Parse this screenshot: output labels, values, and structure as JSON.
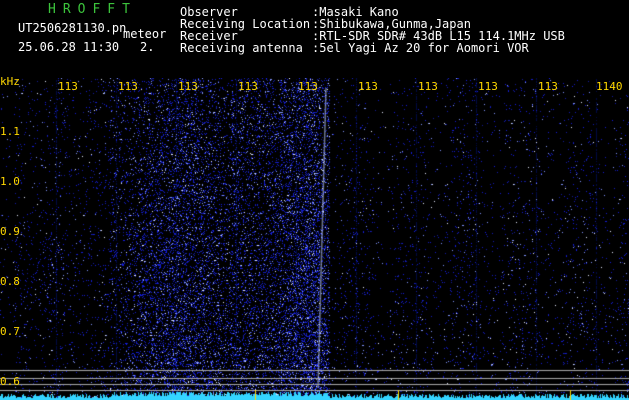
{
  "header": {
    "brand": "HROFFT",
    "filename": "UT2506281130.pn",
    "tag": "meteor",
    "datetime": "25.06.28 11:30",
    "count": "2.",
    "observer_key": "Observer",
    "observer_val": ":Masaki Kano",
    "location_key": "Receiving Location",
    "location_val": ":Shibukawa,Gunma,Japan",
    "receiver_key": "Receiver",
    "receiver_val": ":RTL-SDR SDR# 43dB L15 114.1MHz USB",
    "antenna_key": "Receiving antenna",
    "antenna_val": ":5el Yagi Az 20 for Aomori VOR"
  },
  "axis": {
    "unit": "kHz",
    "x_ticks": [
      "113",
      "113",
      "113",
      "113",
      "113",
      "113",
      "113",
      "113",
      "113",
      "1140"
    ],
    "y_ticks": [
      "1.1",
      "1.0",
      "0.9",
      "0.8",
      "0.7",
      "0.6"
    ]
  },
  "colors": {
    "tick": "#ffd800",
    "brand": "#3cc43c",
    "noise": "#2a38d8",
    "signal": "#9fb4ff"
  }
}
